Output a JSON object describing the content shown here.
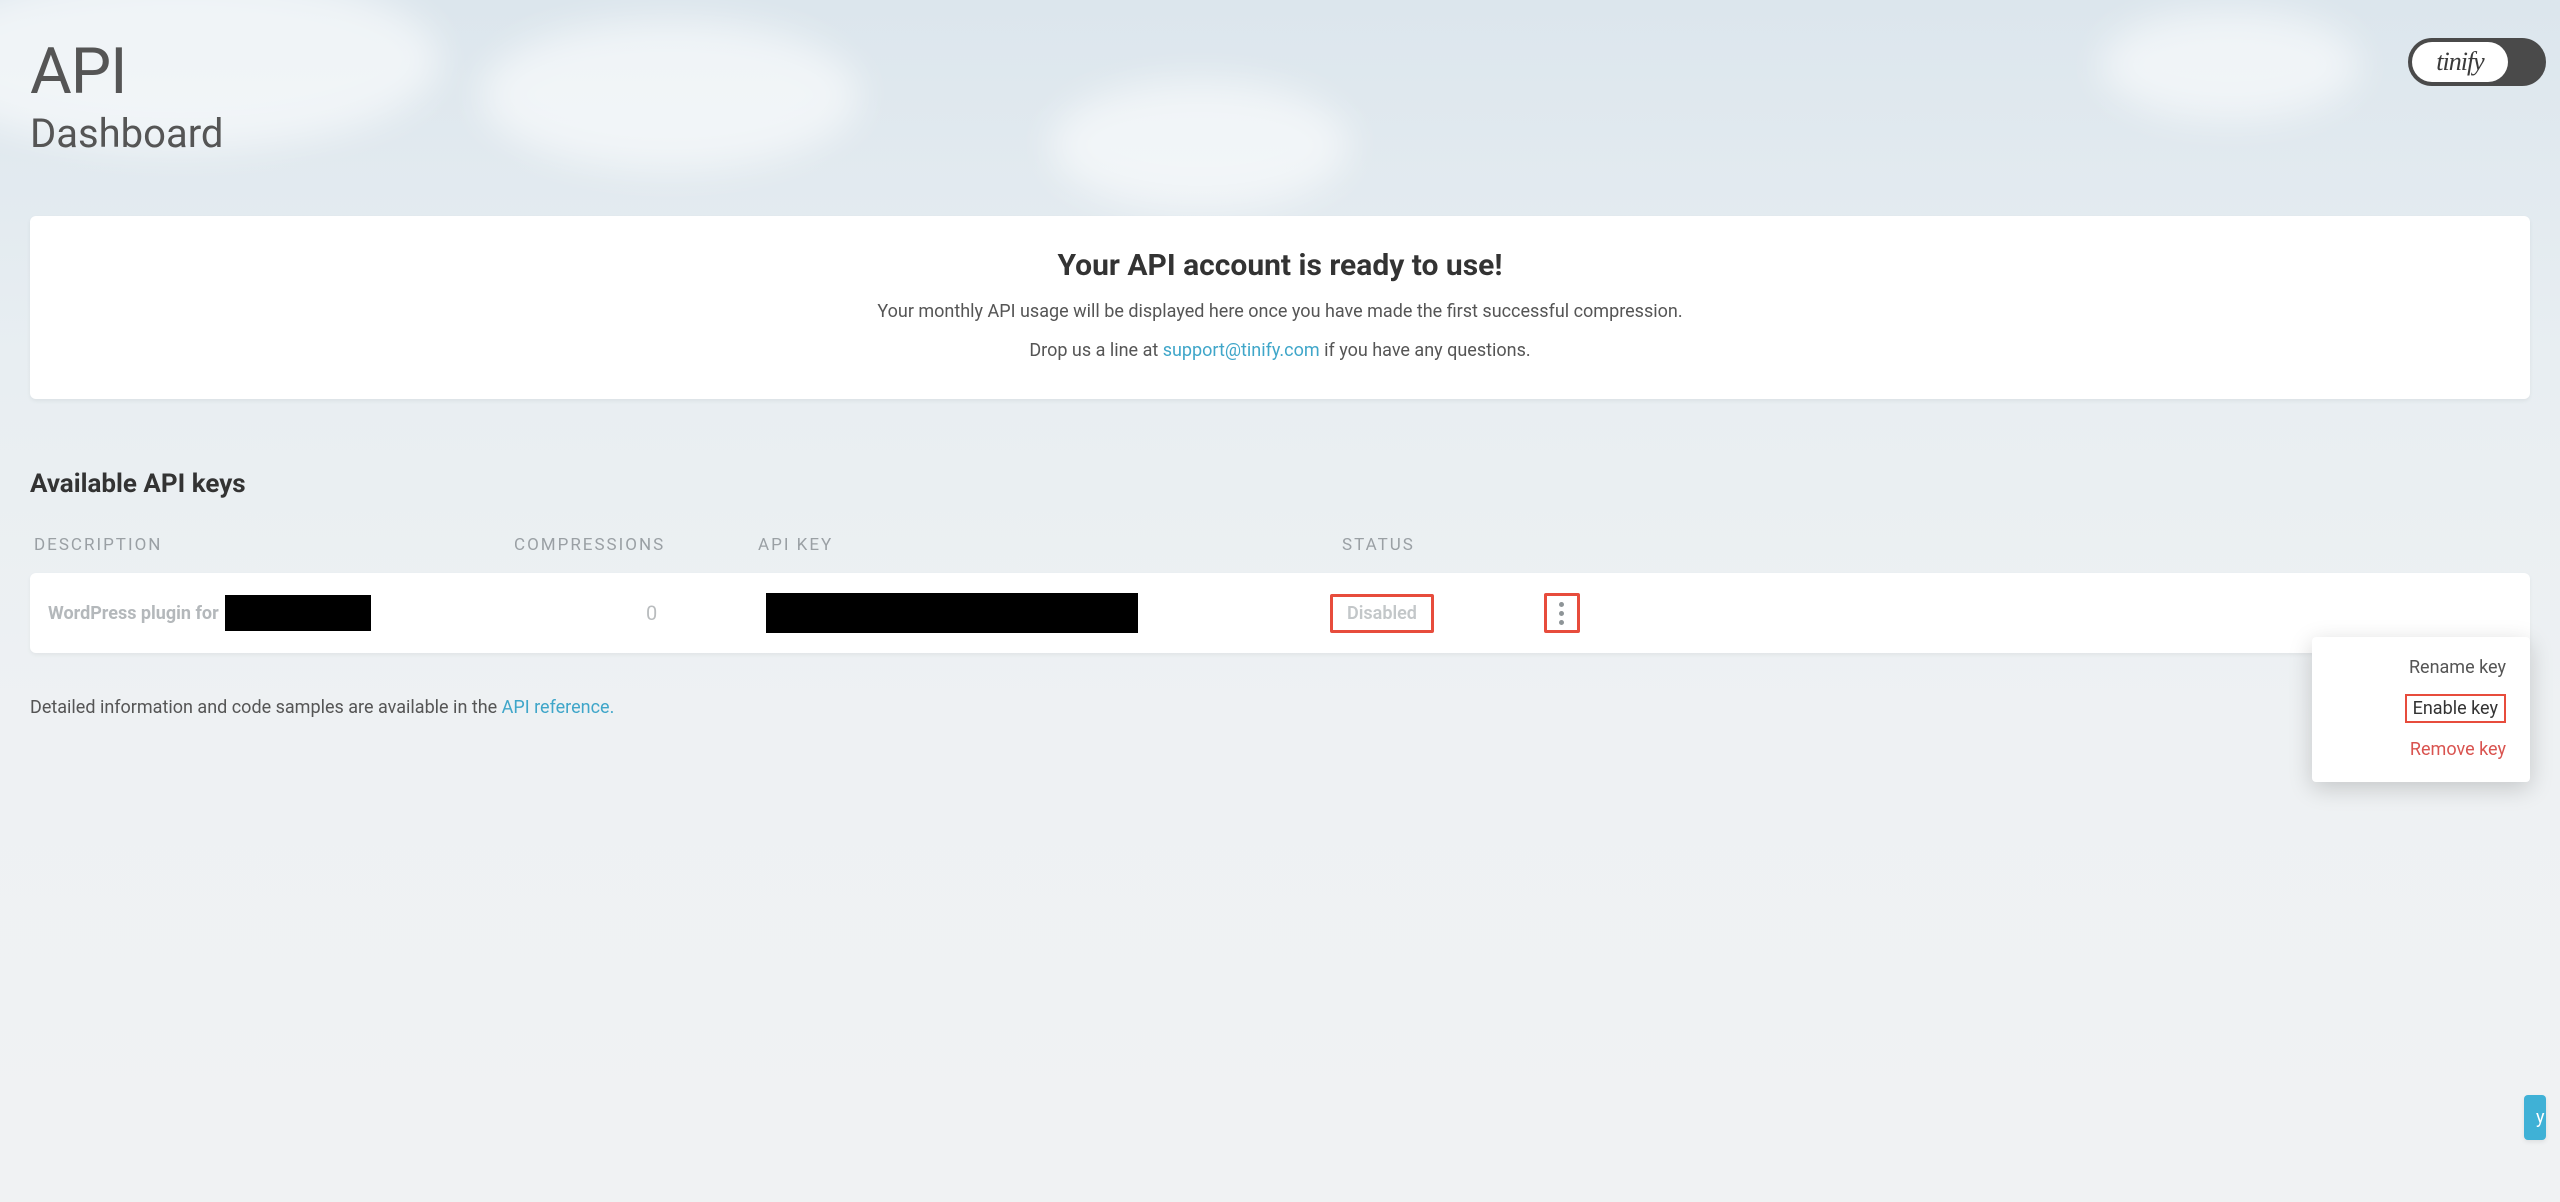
{
  "header": {
    "title_line1": "API",
    "title_line2": "Dashboard",
    "logo_text": "tinify"
  },
  "notice": {
    "title": "Your API account is ready to use!",
    "line1": "Your monthly API usage will be displayed here once you have made the first successful compression.",
    "line2_pre": "Drop us a line at ",
    "support_email": "support@tinify.com",
    "line2_post": " if you have any questions."
  },
  "section_title": "Available API keys",
  "table": {
    "headers": {
      "description": "DESCRIPTION",
      "compressions": "COMPRESSIONS",
      "api_key": "API KEY",
      "status": "STATUS"
    },
    "row": {
      "description_prefix": "WordPress plugin for",
      "compressions": "0",
      "status": "Disabled"
    }
  },
  "menu": {
    "rename": "Rename key",
    "enable": "Enable key",
    "remove": "Remove key"
  },
  "footer": {
    "text_pre": "Detailed information and code samples are available in the ",
    "link_text": "API reference.",
    "add_key_fragment": "y"
  }
}
